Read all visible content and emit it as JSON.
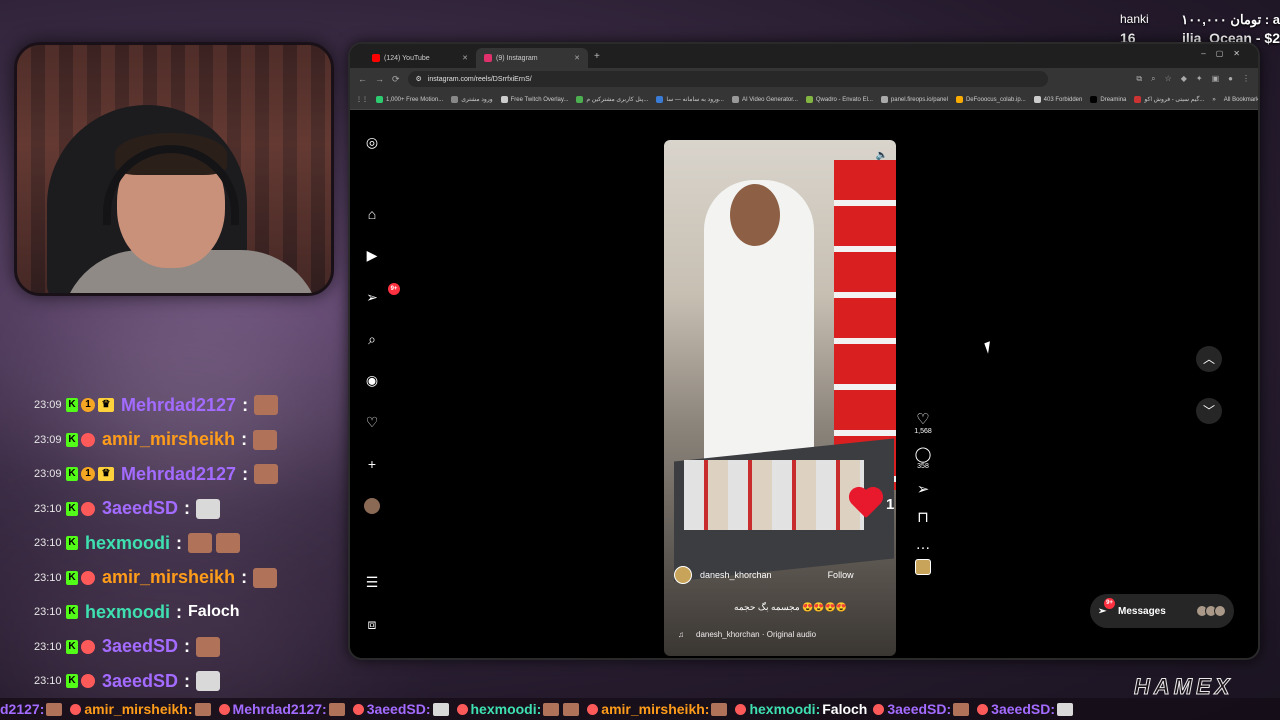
{
  "donation": {
    "user": "hanki",
    "amount": "۱۰۰,۰۰۰ تومان : a",
    "left": "16",
    "text": "ilia_Ocean - $2"
  },
  "chat": [
    {
      "time": "23:09",
      "badges": [
        "k",
        "coin",
        "crown"
      ],
      "user": "Mehrdad2127",
      "color": "#a36bff",
      "emotes": [
        "face"
      ],
      "text": ""
    },
    {
      "time": "23:09",
      "badges": [
        "k",
        "bot"
      ],
      "user": "amir_mirsheikh",
      "color": "#ff9c1a",
      "emotes": [
        "face"
      ],
      "text": ""
    },
    {
      "time": "23:09",
      "badges": [
        "k",
        "coin",
        "crown"
      ],
      "user": "Mehrdad2127",
      "color": "#a36bff",
      "emotes": [
        "face"
      ],
      "text": ""
    },
    {
      "time": "23:10",
      "badges": [
        "k",
        "bot"
      ],
      "user": "3aeedSD",
      "color": "#a36bff",
      "emotes": [
        "cat"
      ],
      "text": ""
    },
    {
      "time": "23:10",
      "badges": [
        "k"
      ],
      "user": "hexmoodi",
      "color": "#3fe0b0",
      "emotes": [
        "face",
        "face"
      ],
      "text": ""
    },
    {
      "time": "23:10",
      "badges": [
        "k",
        "bot"
      ],
      "user": "amir_mirsheikh",
      "color": "#ff9c1a",
      "emotes": [
        "face"
      ],
      "text": ""
    },
    {
      "time": "23:10",
      "badges": [
        "k"
      ],
      "user": "hexmoodi",
      "color": "#3fe0b0",
      "emotes": [],
      "text": "Faloch"
    },
    {
      "time": "23:10",
      "badges": [
        "k",
        "bot"
      ],
      "user": "3aeedSD",
      "color": "#a36bff",
      "emotes": [
        "face"
      ],
      "text": ""
    },
    {
      "time": "23:10",
      "badges": [
        "k",
        "bot"
      ],
      "user": "3aeedSD",
      "color": "#a36bff",
      "emotes": [
        "cat"
      ],
      "text": ""
    }
  ],
  "browser": {
    "tabs": [
      {
        "label": "(124) YouTube",
        "color": "#ff0000",
        "active": false
      },
      {
        "label": "(9) Instagram",
        "color": "#e1306c",
        "active": true
      }
    ],
    "url": "instagram.com/reels/DSrrfxiErnS/",
    "bookmarks": [
      {
        "label": "1,000+ Free Motion...",
        "color": "#2ecc71"
      },
      {
        "label": "ورود مشتری",
        "color": "#888"
      },
      {
        "label": "Free Twitch Overlay...",
        "color": "#ccc"
      },
      {
        "label": "پنل کاربری مشترکین م...",
        "color": "#4caf50"
      },
      {
        "label": "ورود به سامانه — سا...",
        "color": "#3a7bd5"
      },
      {
        "label": "AI Video Generator...",
        "color": "#999"
      },
      {
        "label": "Qwadro - Envato El...",
        "color": "#82b541"
      },
      {
        "label": "panel.fireops.io/panel",
        "color": "#aaa"
      },
      {
        "label": "DeFooocus_colab.ip...",
        "color": "#f9ab00"
      },
      {
        "label": "403 Forbidden",
        "color": "#ccc"
      },
      {
        "label": "Dreamina",
        "color": "#000"
      },
      {
        "label": "گیم سیتی - فروش اکو...",
        "color": "#c33"
      }
    ],
    "all_bookmarks": "All Bookmarks"
  },
  "instagram": {
    "notif_count": "9+",
    "reel": {
      "owner": "danesh_khorchan",
      "follow": "Follow",
      "caption": "مجسمه بگ حجمه 😍😍😍😍",
      "audio": "danesh_khorchan · Original audio",
      "like_overlay": "1"
    },
    "likes": "1,568",
    "comments": "358",
    "messages": "Messages",
    "messages_badge": "9+"
  },
  "ticker": [
    {
      "user": "d2127:",
      "color": "#a36bff",
      "emotes": [
        "face"
      ],
      "text": ""
    },
    {
      "user": "amir_mirsheikh:",
      "color": "#ff9c1a",
      "emotes": [
        "face"
      ],
      "text": ""
    },
    {
      "user": "Mehrdad2127:",
      "color": "#a36bff",
      "emotes": [
        "face"
      ],
      "text": ""
    },
    {
      "user": "3aeedSD:",
      "color": "#a36bff",
      "emotes": [
        "cat"
      ],
      "text": ""
    },
    {
      "user": "hexmoodi:",
      "color": "#3fe0b0",
      "emotes": [
        "face",
        "face"
      ],
      "text": ""
    },
    {
      "user": "amir_mirsheikh:",
      "color": "#ff9c1a",
      "emotes": [
        "face"
      ],
      "text": ""
    },
    {
      "user": "hexmoodi:",
      "color": "#3fe0b0",
      "emotes": [],
      "text": "Faloch"
    },
    {
      "user": "3aeedSD:",
      "color": "#a36bff",
      "emotes": [
        "face"
      ],
      "text": ""
    },
    {
      "user": "3aeedSD:",
      "color": "#a36bff",
      "emotes": [
        "cat"
      ],
      "text": ""
    }
  ],
  "logo": "HAMEX"
}
